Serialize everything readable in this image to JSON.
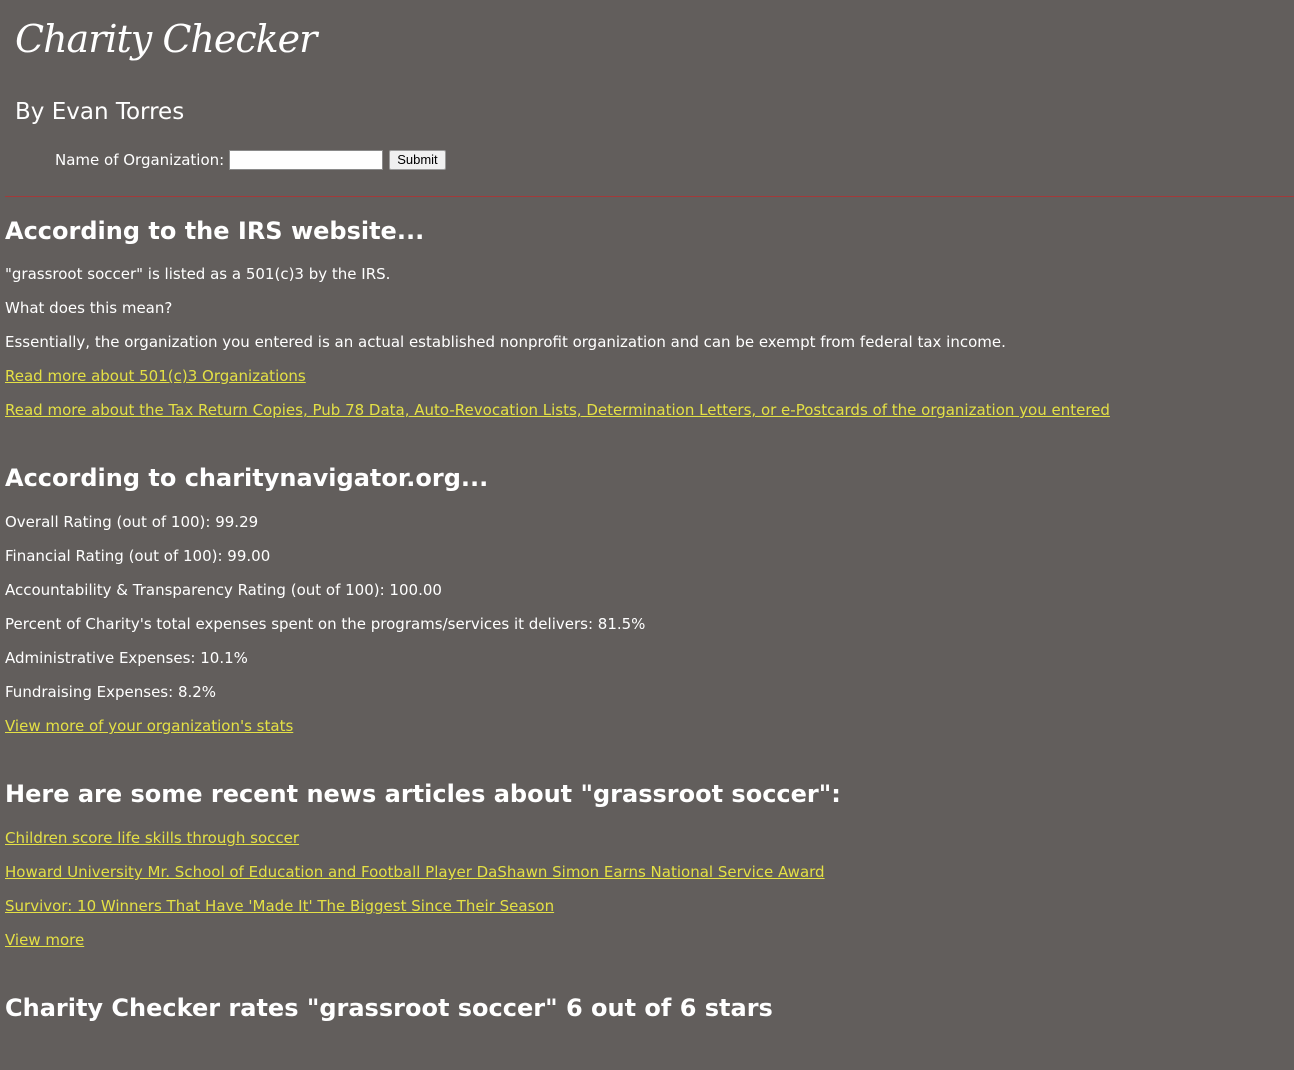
{
  "header": {
    "title": "Charity Checker",
    "byline": "By Evan Torres"
  },
  "search": {
    "label": "Name of Organization:",
    "value": "",
    "placeholder": "",
    "submit_label": "Submit"
  },
  "irs": {
    "heading": "According to the IRS website...",
    "status_text": "\"grassroot soccer\" is listed as a 501(c)3 by the IRS.",
    "question": "What does this mean?",
    "explanation": "Essentially, the organization you entered is an actual established nonprofit organization and can be exempt from federal tax income.",
    "links": [
      "Read more about 501(c)3 Organizations",
      "Read more about the Tax Return Copies, Pub 78 Data, Auto-Revocation Lists, Determination Letters, or e-Postcards of the organization you entered"
    ]
  },
  "charity_navigator": {
    "heading": "According to charitynavigator.org...",
    "stats": [
      "Overall Rating (out of 100): 99.29",
      "Financial Rating (out of 100): 99.00",
      "Accountability & Transparency Rating (out of 100): 100.00",
      "Percent of Charity's total expenses spent on the programs/services it delivers: 81.5%",
      "Administrative Expenses: 10.1%",
      "Fundraising Expenses: 8.2%"
    ],
    "more_link": "View more of your organization's stats"
  },
  "news": {
    "heading": "Here are some recent news articles about \"grassroot soccer\":",
    "articles": [
      "Children score life skills through soccer",
      "Howard University Mr. School of Education and Football Player DaShawn Simon Earns National Service Award",
      "Survivor: 10 Winners That Have 'Made It' The Biggest Since Their Season"
    ],
    "more_link": "View more"
  },
  "rating": {
    "text": "Charity Checker rates \"grassroot soccer\" 6 out of 6 stars"
  },
  "colors": {
    "background": "#625e5c",
    "text": "#ffffff",
    "link": "#e4e045",
    "divider": "#a33a3a"
  }
}
